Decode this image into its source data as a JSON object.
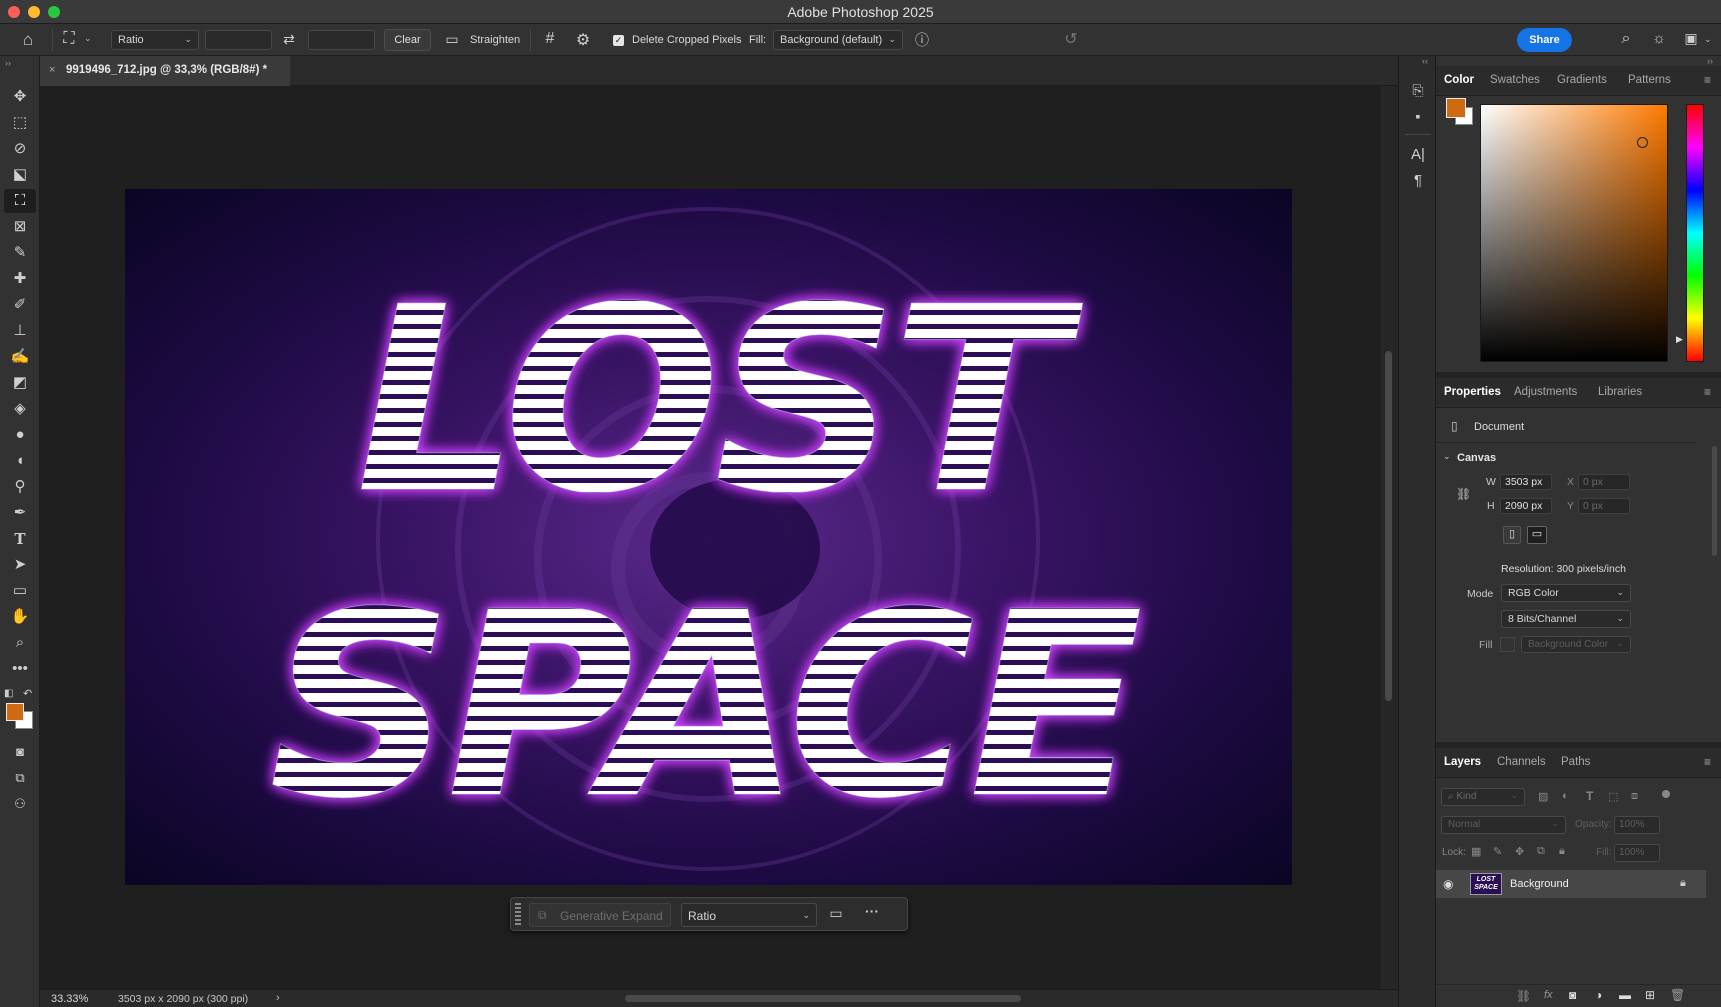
{
  "app": {
    "title": "Adobe Photoshop 2025"
  },
  "options_bar": {
    "ratio": "Ratio",
    "clear": "Clear",
    "straighten": "Straighten",
    "delete_cropped": "Delete Cropped Pixels",
    "fill_label": "Fill:",
    "fill_value": "Background (default)",
    "share": "Share"
  },
  "document": {
    "tab_title": "9919496_712.jpg @ 33,3% (RGB/8#) *"
  },
  "canvas_art": {
    "line1": "LOST",
    "line2": "SPACE"
  },
  "contextual_bar": {
    "generative_expand": "Generative Expand",
    "ratio": "Ratio"
  },
  "status_bar": {
    "zoom": "33.33%",
    "dimensions": "3503 px x 2090 px (300 ppi)"
  },
  "panels": {
    "color_tabs": [
      "Color",
      "Swatches",
      "Gradients",
      "Patterns"
    ],
    "properties_tabs": [
      "Properties",
      "Adjustments",
      "Libraries"
    ],
    "layers_tabs": [
      "Layers",
      "Channels",
      "Paths"
    ]
  },
  "properties": {
    "document": "Document",
    "canvas_title": "Canvas",
    "w_label": "W",
    "h_label": "H",
    "x_label": "X",
    "y_label": "Y",
    "width": "3503 px",
    "height": "2090 px",
    "x": "0 px",
    "y": "0 px",
    "resolution": "Resolution: 300 pixels/inch",
    "mode_label": "Mode",
    "mode": "RGB Color",
    "bits": "8 Bits/Channel",
    "fill_label": "Fill",
    "fill_value": "Background Color"
  },
  "layers": {
    "filter_kind": "Kind",
    "blend_mode": "Normal",
    "opacity_label": "Opacity:",
    "opacity": "100%",
    "lock_label": "Lock:",
    "fill_label": "Fill:",
    "fill": "100%",
    "layer_name": "Background",
    "thumbnail_text_1": "LOST",
    "thumbnail_text_2": "SPACE"
  },
  "colors": {
    "foreground": "#d06a12",
    "background": "#ffffff",
    "accent": "#1473e6"
  }
}
